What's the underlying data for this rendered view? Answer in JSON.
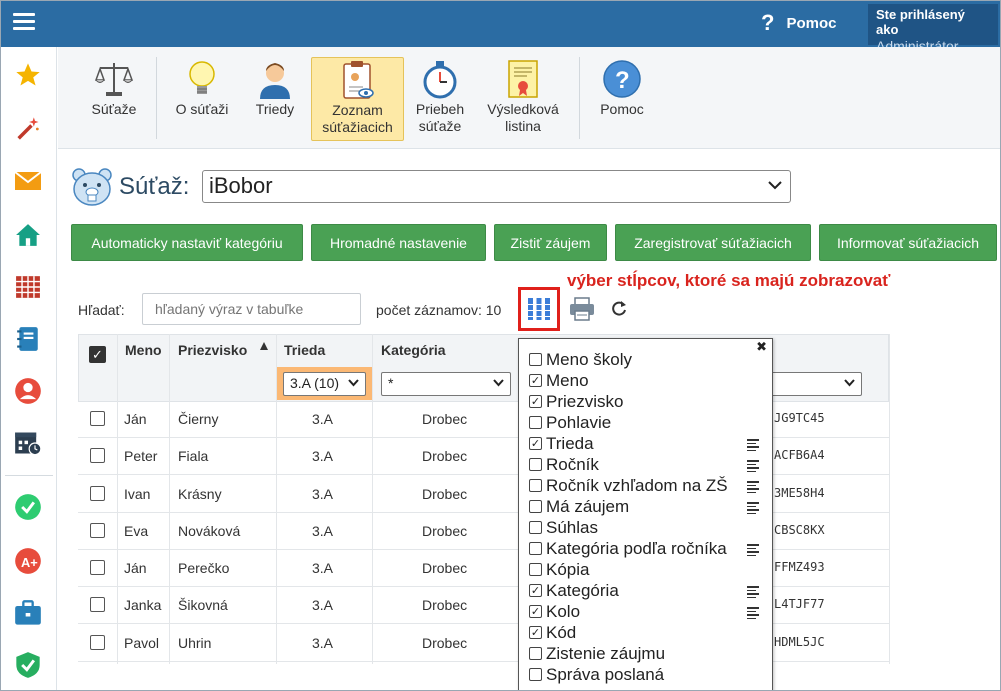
{
  "header": {
    "help_label": "Pomoc",
    "user_line1": "Ste prihlásený ako",
    "user_line2": "Administrátor"
  },
  "sidebar": {
    "items": [
      "star-icon",
      "magic-wand-icon",
      "envelope-icon",
      "home-icon",
      "calendar-grid-icon",
      "notebook-icon",
      "user-circle-icon",
      "calendar-clock-icon",
      "check-badge-icon",
      "grade-badge-icon",
      "briefcase-icon",
      "shield-check-icon"
    ]
  },
  "ribbon": {
    "items": [
      {
        "line1": "Súťaže",
        "line2": ""
      },
      {
        "line1": "O súťaži",
        "line2": ""
      },
      {
        "line1": "Triedy",
        "line2": ""
      },
      {
        "line1": "Zoznam",
        "line2": "súťažiacich"
      },
      {
        "line1": "Priebeh",
        "line2": "súťaže"
      },
      {
        "line1": "Výsledková",
        "line2": "listina"
      },
      {
        "line1": "Pomoc",
        "line2": ""
      }
    ]
  },
  "contest": {
    "label": "Súťaž:",
    "selected": "iBobor"
  },
  "actions": {
    "auto_category": "Automaticky nastaviť kategóriu",
    "bulk_settings": "Hromadné nastavenie",
    "find_interest": "Zistiť záujem",
    "register": "Zaregistrovať súťažiacich",
    "inform": "Informovať súťažiacich"
  },
  "annotation": "výber stĺpcov, ktoré sa majú zobrazovať",
  "search": {
    "label": "Hľadať:",
    "placeholder": "hľadaný výraz v tabuľke",
    "count_label": "počet záznamov: 10"
  },
  "table": {
    "headers": {
      "meno": "Meno",
      "priezvisko": "Priezvisko",
      "trieda": "Trieda",
      "kategoria": "Kategória"
    },
    "filters": {
      "trieda": "3.A (10)",
      "kategoria": "*",
      "last": ""
    },
    "rows": [
      {
        "meno": "Ján",
        "priezvisko": "Čierny",
        "trieda": "3.A",
        "kategoria": "Drobec",
        "kod": "JG9TC45"
      },
      {
        "meno": "Peter",
        "priezvisko": "Fiala",
        "trieda": "3.A",
        "kategoria": "Drobec",
        "kod": "ACFB6A4"
      },
      {
        "meno": "Ivan",
        "priezvisko": "Krásny",
        "trieda": "3.A",
        "kategoria": "Drobec",
        "kod": "3ME58H4"
      },
      {
        "meno": "Eva",
        "priezvisko": "Nováková",
        "trieda": "3.A",
        "kategoria": "Drobec",
        "kod": "CBSC8KX"
      },
      {
        "meno": "Ján",
        "priezvisko": "Perečko",
        "trieda": "3.A",
        "kategoria": "Drobec",
        "kod": "FFMZ493"
      },
      {
        "meno": "Janka",
        "priezvisko": "Šikovná",
        "trieda": "3.A",
        "kategoria": "Drobec",
        "kod": "L4TJF77"
      },
      {
        "meno": "Pavol",
        "priezvisko": "Uhrin",
        "trieda": "3.A",
        "kategoria": "Drobec",
        "kod": "HDML5JC"
      }
    ]
  },
  "column_picker": {
    "items": [
      {
        "label": "Meno školy",
        "checked": false,
        "lines": false
      },
      {
        "label": "Meno",
        "checked": true,
        "lines": false
      },
      {
        "label": "Priezvisko",
        "checked": true,
        "lines": false
      },
      {
        "label": "Pohlavie",
        "checked": false,
        "lines": false
      },
      {
        "label": "Trieda",
        "checked": true,
        "lines": true
      },
      {
        "label": "Ročník",
        "checked": false,
        "lines": true
      },
      {
        "label": "Ročník vzhľadom na ZŠ",
        "checked": false,
        "lines": true
      },
      {
        "label": "Má záujem",
        "checked": false,
        "lines": true
      },
      {
        "label": "Súhlas",
        "checked": false,
        "lines": false
      },
      {
        "label": "Kategória podľa ročníka",
        "checked": false,
        "lines": true
      },
      {
        "label": "Kópia",
        "checked": false,
        "lines": false
      },
      {
        "label": "Kategória",
        "checked": true,
        "lines": true
      },
      {
        "label": "Kolo",
        "checked": true,
        "lines": true
      },
      {
        "label": "Kód",
        "checked": true,
        "lines": false
      },
      {
        "label": "Zistenie záujmu",
        "checked": false,
        "lines": false
      },
      {
        "label": "Správa poslaná",
        "checked": false,
        "lines": false
      }
    ]
  },
  "colors": {
    "topbar": "#2b6ca3",
    "button_green": "#4aa154",
    "annotation_red": "#d9241e",
    "active_ribbon": "#fde9a6",
    "trieda_filter": "#fbb874"
  }
}
